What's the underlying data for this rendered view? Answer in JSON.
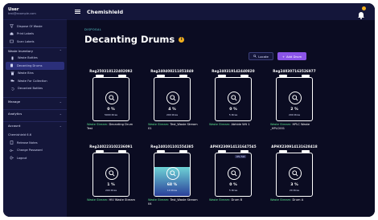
{
  "app": {
    "title": "Chemishield"
  },
  "user": {
    "name": "User",
    "email": "test@example.com"
  },
  "sidebar": {
    "top_items": [
      {
        "label": "Dispose Of Waste",
        "icon": "funnel-icon"
      },
      {
        "label": "Print Labels",
        "icon": "printer-icon"
      },
      {
        "label": "Scan Labels",
        "icon": "scan-icon"
      }
    ],
    "sections": {
      "waste_inventory": "Waste Inventory",
      "manage": "Manage",
      "analytics": "Analytics",
      "account": "Account"
    },
    "waste_items": [
      {
        "label": "Waste Bottles",
        "icon": "bottle-icon"
      },
      {
        "label": "Decanting Drums",
        "icon": "drum-icon"
      },
      {
        "label": "Waste Bins",
        "icon": "bin-icon"
      },
      {
        "label": "Waste For Collection",
        "icon": "truck-icon"
      },
      {
        "label": "Decanted Bottles",
        "icon": "undo-icon"
      }
    ],
    "version": "Chemishield 6.6",
    "account_items": [
      {
        "label": "Release Notes",
        "icon": "notes-icon"
      },
      {
        "label": "Change Password",
        "icon": "key-icon"
      },
      {
        "label": "Logout",
        "icon": "logout-icon"
      }
    ]
  },
  "breadcrumb": "DISPOSAL",
  "page_title": "Decanting Drums",
  "buttons": {
    "locate": "Locate",
    "add": "Add Drum"
  },
  "drums": [
    {
      "id": "Reg250318122402092",
      "percent": "0 %",
      "amount": "5000 litres",
      "stream_key": "Waste Stream:",
      "stream_val": "Decanting Drum Test",
      "fill": 0
    },
    {
      "id": "Reg240408211851849",
      "percent": "4 %",
      "amount": "200 litres",
      "stream_key": "Waste Stream:",
      "stream_val": "Test_Waste Stream 01",
      "fill": 0
    },
    {
      "id": "Reg240319142440820",
      "percent": "0 %",
      "amount": "5 litres",
      "stream_key": "Waste Stream:",
      "stream_val": "Abhide Wit 1",
      "fill": 0
    },
    {
      "id": "Reg240307163526977",
      "percent": "2 %",
      "amount": "200 litres",
      "stream_key": "Waste Stream:",
      "stream_val": "HPLC Waste _HPLC001",
      "fill": 0
    },
    {
      "id": "Reg240223102236091",
      "percent": "1 %",
      "amount": "200 litres",
      "stream_key": "Waste Stream:",
      "stream_val": "HIV Waste Stream",
      "fill": 0
    },
    {
      "id": "Reg240101101554385",
      "percent": "68 %",
      "amount": "10 litres",
      "stream_key": "Waste Stream:",
      "stream_val": "Test_Waste Stream 04",
      "fill": 0.68
    },
    {
      "id": "APHX230914131647545",
      "percent": "0 %",
      "amount": "5 litres",
      "stream_key": "Waste Stream:",
      "stream_val": "Drum B",
      "fill": 0,
      "badge": "0% full"
    },
    {
      "id": "APHX230914131628418",
      "percent": "3 %",
      "amount": "20 litres",
      "stream_key": "Waste Stream:",
      "stream_val": "Drum A",
      "fill": 0
    }
  ]
}
